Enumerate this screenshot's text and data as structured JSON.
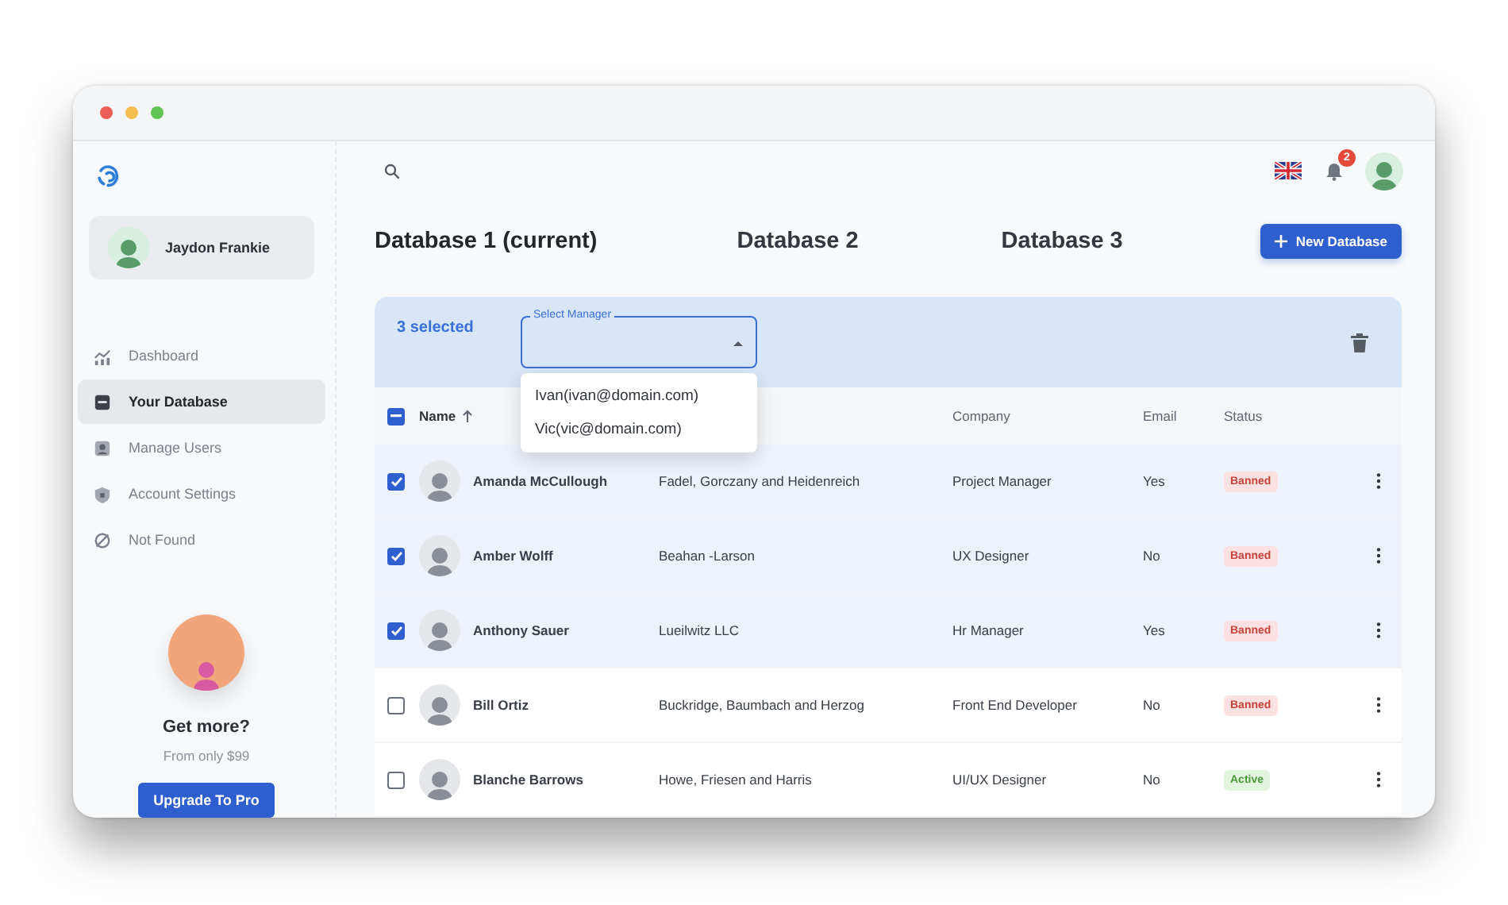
{
  "sidebar": {
    "user": {
      "name": "Jaydon Frankie"
    },
    "items": [
      {
        "label": "Dashboard",
        "kind": "chart",
        "selected": false
      },
      {
        "label": "Your Database",
        "kind": "database",
        "selected": true
      },
      {
        "label": "Manage Users",
        "kind": "user",
        "selected": false
      },
      {
        "label": "Account Settings",
        "kind": "lock",
        "selected": false
      },
      {
        "label": "Not Found",
        "kind": "block",
        "selected": false
      }
    ],
    "promo": {
      "title": "Get more?",
      "subtitle": "From only $99",
      "button": "Upgrade To Pro"
    }
  },
  "header": {
    "notifications": "2"
  },
  "databases": [
    {
      "label": "Database 1 (current)",
      "selected": true
    },
    {
      "label": "Database 2",
      "selected": false
    },
    {
      "label": "Database 3",
      "selected": false
    }
  ],
  "new_database_button": "New Database",
  "toolbar": {
    "selected_count": "3 selected",
    "select": {
      "label": "Select Manager",
      "expanded": true,
      "options": [
        "Ivan(ivan@domain.com)",
        "Vic(vic@domain.com)"
      ]
    }
  },
  "table": {
    "header_checkbox": {
      "indeterminate": true
    },
    "columns": [
      {
        "label": "Name",
        "sorted": true
      },
      {
        "label": "Company"
      },
      {
        "label": "Email"
      },
      {
        "label": "Status"
      }
    ],
    "rows": [
      {
        "selected": true,
        "name": "Amanda McCullough",
        "column_2": "Fadel, Gorczany and Heidenreich",
        "company": "Project Manager",
        "email": "Yes",
        "status": {
          "label": "Banned",
          "kind": "banned"
        }
      },
      {
        "selected": true,
        "name": "Amber Wolff",
        "column_2": "Beahan -Larson",
        "company": "UX Designer",
        "email": "No",
        "status": {
          "label": "Banned",
          "kind": "banned"
        }
      },
      {
        "selected": true,
        "name": "Anthony Sauer",
        "column_2": "Lueilwitz LLC",
        "company": "Hr Manager",
        "email": "Yes",
        "status": {
          "label": "Banned",
          "kind": "banned"
        }
      },
      {
        "selected": false,
        "name": "Bill Ortiz",
        "column_2": "Buckridge, Baumbach and Herzog",
        "company": "Front End Developer",
        "email": "No",
        "status": {
          "label": "Banned",
          "kind": "banned"
        }
      },
      {
        "selected": false,
        "name": "Blanche Barrows",
        "column_2": "Howe, Friesen and Harris",
        "company": "UI/UX Designer",
        "email": "No",
        "status": {
          "label": "Active",
          "kind": "active"
        }
      }
    ]
  }
}
